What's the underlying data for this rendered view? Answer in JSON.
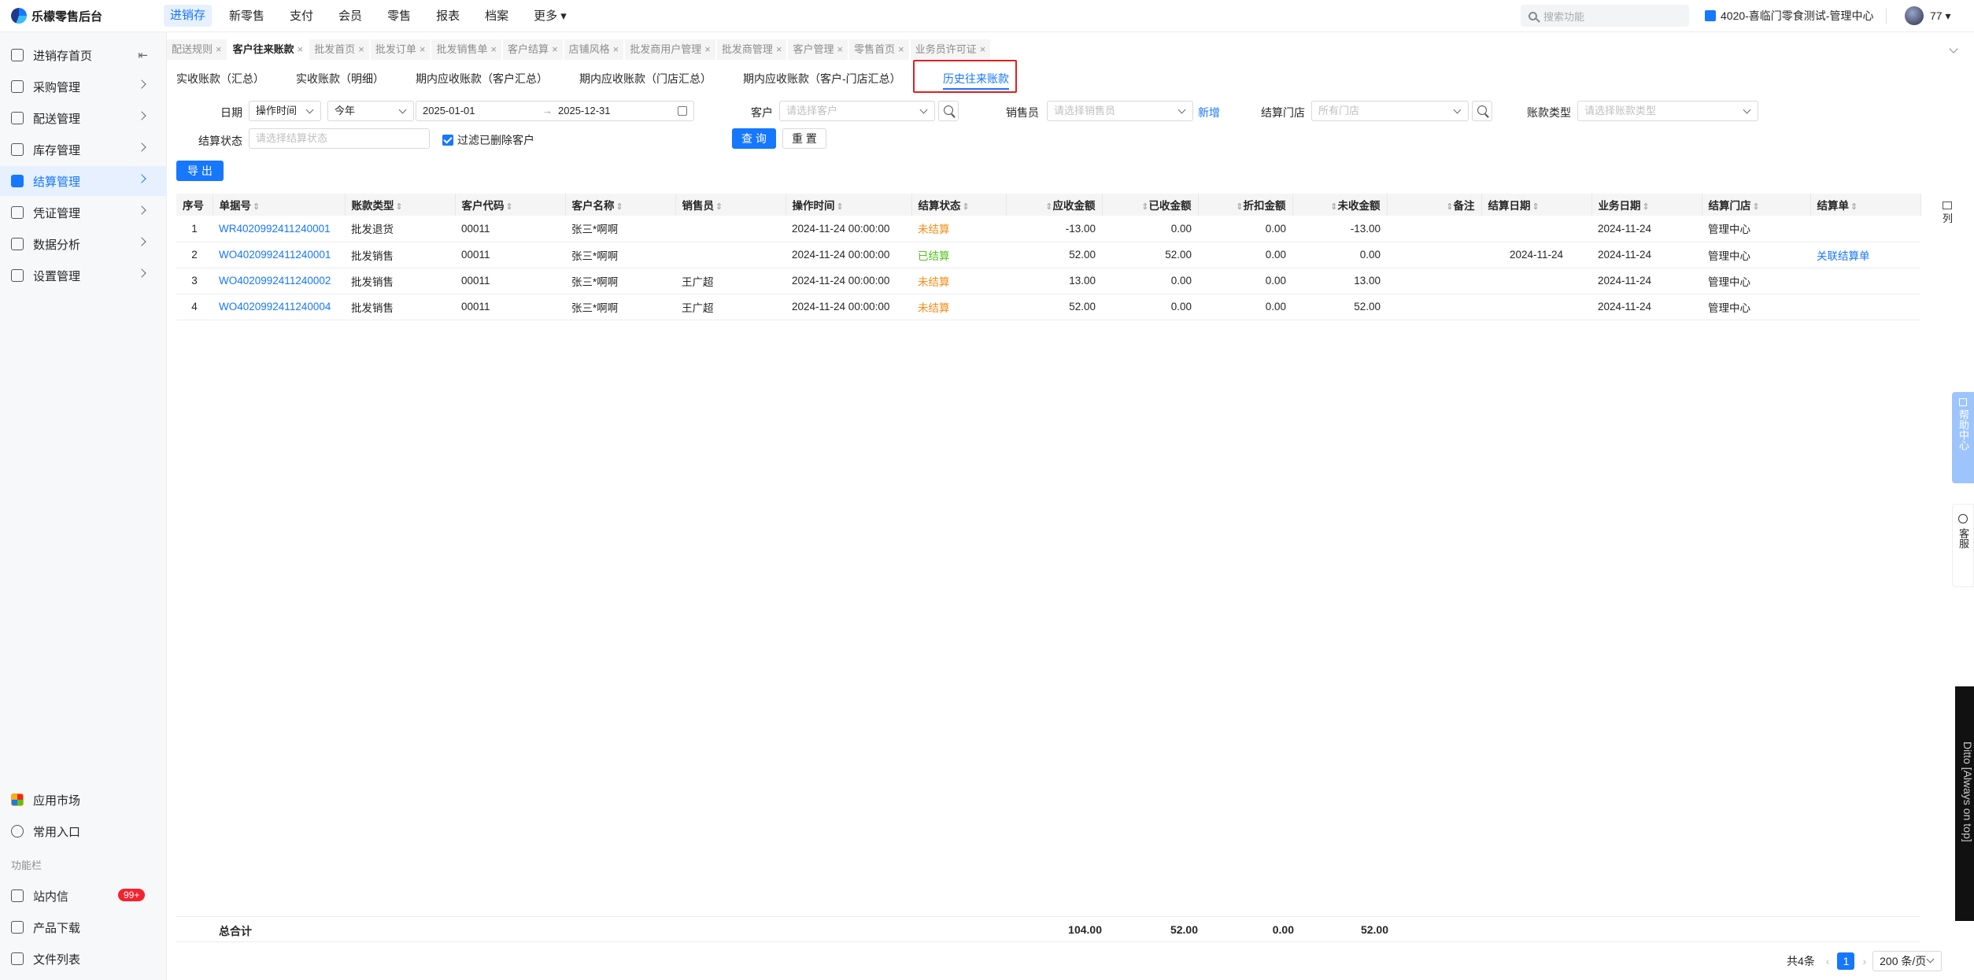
{
  "app": {
    "title": "乐檬零售后台"
  },
  "topnav": {
    "items": [
      {
        "label": "进销存",
        "active": true
      },
      {
        "label": "新零售"
      },
      {
        "label": "支付"
      },
      {
        "label": "会员"
      },
      {
        "label": "零售"
      },
      {
        "label": "报表"
      },
      {
        "label": "档案"
      },
      {
        "label": "更多 ▾"
      }
    ],
    "search_placeholder": "搜索功能",
    "store": "4020-喜临门零食测试-管理中心",
    "user": "77 ▾"
  },
  "sidebar": {
    "items": [
      {
        "label": "进销存首页",
        "collapse": "⇤"
      },
      {
        "label": "采购管理"
      },
      {
        "label": "配送管理"
      },
      {
        "label": "库存管理"
      },
      {
        "label": "结算管理",
        "active": true
      },
      {
        "label": "凭证管理"
      },
      {
        "label": "数据分析"
      },
      {
        "label": "设置管理"
      }
    ],
    "bottom": [
      {
        "label": "应用市场"
      },
      {
        "label": "常用入口"
      }
    ],
    "section": "功能栏",
    "extras": [
      {
        "label": "站内信",
        "badge": "99+"
      },
      {
        "label": "产品下载"
      },
      {
        "label": "文件列表"
      }
    ]
  },
  "tabs": [
    {
      "label": "配送规则"
    },
    {
      "label": "客户往来账款",
      "active": true
    },
    {
      "label": "批发首页"
    },
    {
      "label": "批发订单"
    },
    {
      "label": "批发销售单"
    },
    {
      "label": "客户结算"
    },
    {
      "label": "店铺风格"
    },
    {
      "label": "批发商用户管理"
    },
    {
      "label": "批发商管理"
    },
    {
      "label": "客户管理"
    },
    {
      "label": "零售首页"
    },
    {
      "label": "业务员许可证"
    }
  ],
  "subtabs": [
    {
      "label": "实收账款（汇总）"
    },
    {
      "label": "实收账款（明细）"
    },
    {
      "label": "期内应收账款（客户汇总）"
    },
    {
      "label": "期内应收账款（门店汇总）"
    },
    {
      "label": "期内应收账款（客户-门店汇总）"
    },
    {
      "label": "历史往来账款",
      "active": true
    }
  ],
  "filters": {
    "date_label": "日期",
    "date_type": "操作时间",
    "date_range": "今年",
    "date_start": "2025-01-01",
    "date_sep": "→",
    "date_end": "2025-12-31",
    "customer_label": "客户",
    "customer_placeholder": "请选择客户",
    "salesman_label": "销售员",
    "salesman_placeholder": "请选择销售员",
    "add_label": "新增",
    "store_label": "结算门店",
    "store_placeholder": "所有门店",
    "type_label": "账款类型",
    "type_placeholder": "请选择账款类型",
    "status_label": "结算状态",
    "status_placeholder": "请选择结算状态",
    "filter_deleted": "过滤已删除客户",
    "query": "查 询",
    "reset": "重 置",
    "export": "导 出"
  },
  "table": {
    "headers": [
      "序号",
      "单据号",
      "账款类型",
      "客户代码",
      "客户名称",
      "销售员",
      "操作时间",
      "结算状态",
      "应收金额",
      "已收金额",
      "折扣金额",
      "未收金额",
      "备注",
      "结算日期",
      "业务日期",
      "结算门店",
      "结算单"
    ],
    "rows": [
      {
        "idx": "1",
        "doc": "WR4020992411240001",
        "type": "批发退货",
        "code": "00011",
        "name": "张三*啊啊",
        "sales": "",
        "time": "2024-11-24 00:00:00",
        "status": "未结算",
        "recv": "-13.00",
        "got": "0.00",
        "disc": "0.00",
        "unpaid": "-13.00",
        "note": "",
        "sdate": "",
        "bdate": "2024-11-24",
        "store": "管理中心",
        "sbill": ""
      },
      {
        "idx": "2",
        "doc": "WO4020992411240001",
        "type": "批发销售",
        "code": "00011",
        "name": "张三*啊啊",
        "sales": "",
        "time": "2024-11-24 00:00:00",
        "status": "已结算",
        "recv": "52.00",
        "got": "52.00",
        "disc": "0.00",
        "unpaid": "0.00",
        "note": "",
        "sdate": "2024-11-24",
        "bdate": "2024-11-24",
        "store": "管理中心",
        "sbill": "关联结算单"
      },
      {
        "idx": "3",
        "doc": "WO4020992411240002",
        "type": "批发销售",
        "code": "00011",
        "name": "张三*啊啊",
        "sales": "王广超",
        "time": "2024-11-24 00:00:00",
        "status": "未结算",
        "recv": "13.00",
        "got": "0.00",
        "disc": "0.00",
        "unpaid": "13.00",
        "note": "",
        "sdate": "",
        "bdate": "2024-11-24",
        "store": "管理中心",
        "sbill": ""
      },
      {
        "idx": "4",
        "doc": "WO4020992411240004",
        "type": "批发销售",
        "code": "00011",
        "name": "张三*啊啊",
        "sales": "王广超",
        "time": "2024-11-24 00:00:00",
        "status": "未结算",
        "recv": "52.00",
        "got": "0.00",
        "disc": "0.00",
        "unpaid": "52.00",
        "note": "",
        "sdate": "",
        "bdate": "2024-11-24",
        "store": "管理中心",
        "sbill": ""
      }
    ],
    "totals": {
      "label": "总合计",
      "recv": "104.00",
      "got": "52.00",
      "disc": "0.00",
      "unpaid": "52.00"
    }
  },
  "side_widgets": {
    "columns": "列",
    "help": "帮助中心",
    "service": "客服",
    "ditto": "Ditto [Always on top]"
  },
  "pager": {
    "total": "共4条",
    "prev": "‹",
    "page": "1",
    "next": "›",
    "size": "200 条/页"
  },
  "colors": {
    "accent": "#1677ff",
    "unpaid": "#fa8c16",
    "paid": "#52c41a",
    "highlight": "#e02020"
  }
}
